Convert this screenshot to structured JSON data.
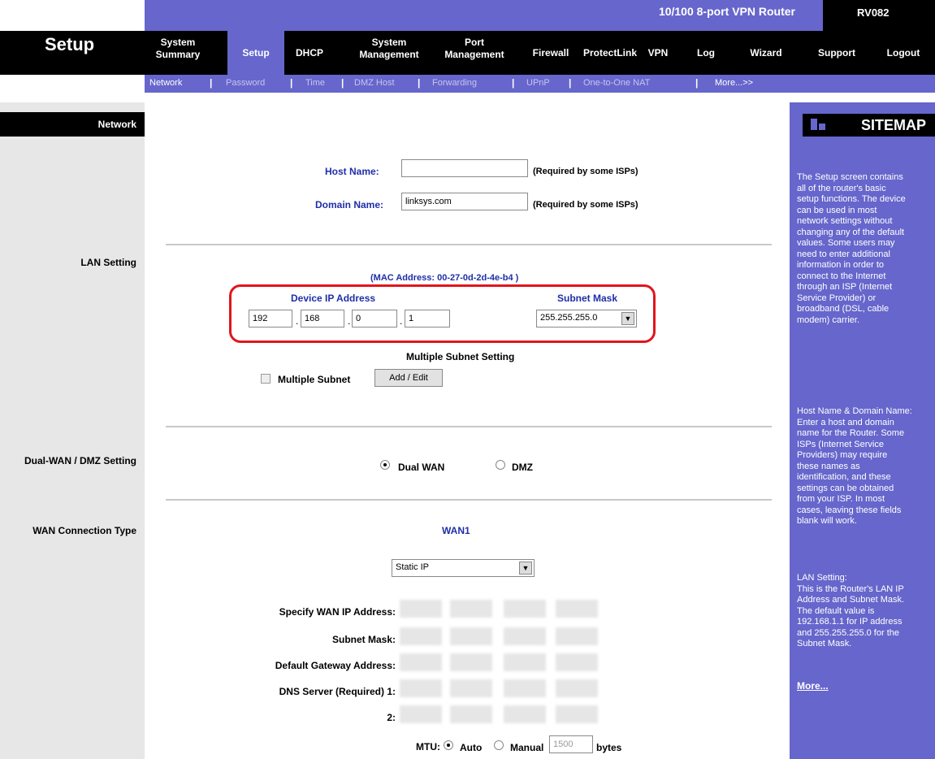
{
  "header": {
    "product_name": "10/100 8-port VPN Router",
    "model": "RV082",
    "page_title": "Setup",
    "nav": [
      {
        "label": "System\nSummary"
      },
      {
        "label": "Setup"
      },
      {
        "label": "DHCP"
      },
      {
        "label": "System\nManagement"
      },
      {
        "label": "Port\nManagement"
      },
      {
        "label": "Firewall"
      },
      {
        "label": "ProtectLink"
      },
      {
        "label": "VPN"
      },
      {
        "label": "Log"
      },
      {
        "label": "Wizard"
      },
      {
        "label": "Support"
      },
      {
        "label": "Logout"
      }
    ],
    "subnav": [
      "Network",
      "Password",
      "Time",
      "DMZ Host",
      "Forwarding",
      "UPnP",
      "One-to-One NAT",
      "More...>>"
    ]
  },
  "left": {
    "section": "Network",
    "lan": "LAN Setting",
    "dualwan": "Dual-WAN / DMZ Setting",
    "wanconn": "WAN Connection Type"
  },
  "host": {
    "host_label": "Host Name:",
    "host_value": "",
    "host_hint": "(Required by some ISPs)",
    "domain_label": "Domain Name:",
    "domain_value": "linksys.com",
    "domain_hint": "(Required by some ISPs)"
  },
  "lan": {
    "mac": "(MAC Address: 00-27-0d-2d-4e-b4 )",
    "ip_label": "Device IP Address",
    "ip": [
      "192",
      "168",
      "0",
      "1"
    ],
    "dot": ".",
    "mask_label": "Subnet Mask",
    "mask_value": "255.255.255.0",
    "multi_title": "Multiple Subnet Setting",
    "multi_label": "Multiple Subnet",
    "multi_button": "Add / Edit"
  },
  "dualwan": {
    "opt1": "Dual WAN",
    "opt2": "DMZ",
    "selected": "Dual WAN"
  },
  "wan": {
    "title": "WAN1",
    "type_value": "Static IP",
    "rows": [
      "Specify WAN IP Address:",
      "Subnet Mask:",
      "Default Gateway Address:",
      "DNS Server (Required) 1:",
      "2:"
    ],
    "mtu_label": "MTU:",
    "mtu_auto": "Auto",
    "mtu_manual": "Manual",
    "mtu_value": "1500",
    "mtu_unit": "bytes"
  },
  "sitemap": {
    "title": "SITEMAP",
    "p1": "The Setup screen contains\nall of the router's basic\nsetup functions. The device\ncan be used in most\nnetwork settings without\nchanging any of the default\nvalues. Some users may\nneed to enter additional\ninformation in order to\nconnect to the Internet\nthrough an ISP (Internet\nService Provider) or\nbroadband (DSL, cable\nmodem) carrier.",
    "p2": "Host Name & Domain Name:\nEnter a host and domain\nname for the Router. Some\nISPs (Internet Service\nProviders) may require\nthese names as\nidentification, and these\nsettings can be obtained\nfrom your ISP. In most\ncases, leaving these fields\nblank will work.",
    "p3": "LAN Setting:\nThis is the Router's LAN IP\nAddress and Subnet Mask.\nThe default value is\n192.168.1.1 for IP address\nand 255.255.255.0 for the\nSubnet Mask.",
    "more": "More..."
  },
  "colors": {
    "accent": "#6666cc",
    "label_blue": "#1f2ea8",
    "highlight": "#e0161c"
  }
}
